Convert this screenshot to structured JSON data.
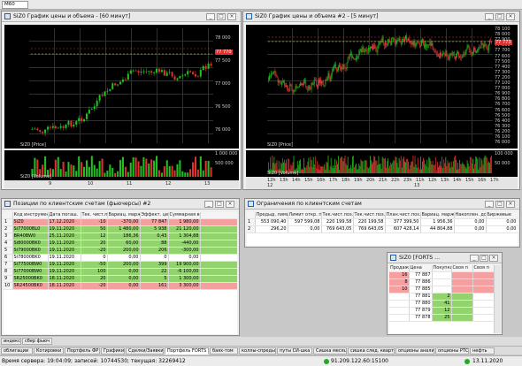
{
  "toolbar": {
    "timeframe": "M60"
  },
  "chart1": {
    "title": "SiZ0 График цены и объема - [60 минут]",
    "price_label": "SiZ0 [Price]",
    "volume_label": "SiZ0 [Volume]",
    "y_ticks": [
      "78 000",
      "77 500",
      "77 000",
      "76 500",
      "76 000"
    ],
    "last_price": "77 770",
    "vol_ticks": [
      "1 000 000",
      "500 000"
    ],
    "x_ticks": [
      "9",
      "10",
      "11",
      "12",
      "13"
    ]
  },
  "chart2": {
    "title": "SiZ0 График цены и объема #2 - [5 минут]",
    "price_label": "SiZ0 [Price]",
    "volume_label": "SiZ0 [Volume]",
    "y_ticks": [
      "78 100",
      "78 000",
      "77 900",
      "77 800",
      "77 700",
      "77 600",
      "77 500",
      "77 400",
      "77 300",
      "77 200",
      "77 100",
      "77 000",
      "76 900",
      "76 800",
      "76 700",
      "76 600",
      "76 500",
      "76 400",
      "76 300",
      "76 200",
      "76 100",
      "76 000"
    ],
    "last_price": "77 773",
    "vol_ticks": [
      "100 000",
      "50 000"
    ],
    "x_ticks": [
      "12h",
      "13h",
      "14h",
      "15h",
      "16h",
      "17h",
      "18h",
      "19h",
      "20h",
      "21h",
      "22h",
      "23h",
      "11h",
      "12h",
      "13h",
      "14h",
      "15h",
      "16h",
      "17h"
    ],
    "x_days": [
      "12",
      "13"
    ]
  },
  "positions": {
    "title": "Позиции по клиентским счетам (фьючерсы) #2",
    "headers": [
      "Код инструмента",
      "Дата погаш.",
      "Тек. чист.поз.",
      "Вариац. маржа",
      "Эффект. цена",
      "Суммарная в."
    ],
    "rows": [
      {
        "n": "1",
        "code": "SiZ0",
        "date": "17.12.2020",
        "pos": "-10",
        "vm": "-370,00",
        "price": "77 847",
        "sum": "1 980,00",
        "cls": "red"
      },
      {
        "n": "2",
        "code": "Si77000BL0",
        "date": "19.11.2020",
        "pos": "50",
        "vm": "1 480,00",
        "price": "5 938",
        "sum": "21 120,00",
        "cls": "grn"
      },
      {
        "n": "3",
        "code": "BR40BW0",
        "date": "25.11.2020",
        "pos": "12",
        "vm": "186,36",
        "price": "0,43",
        "sum": "1 304,88",
        "cls": "grn"
      },
      {
        "n": "4",
        "code": "Si80000BK0",
        "date": "19.11.2020",
        "pos": "20",
        "vm": "60,00",
        "price": "88",
        "sum": "-440,00",
        "cls": "grn"
      },
      {
        "n": "5",
        "code": "Si79000BK0",
        "date": "19.11.2020",
        "pos": "-20",
        "vm": "200,00",
        "price": "206",
        "sum": "-300,00",
        "cls": "grn"
      },
      {
        "n": "6",
        "code": "Si78000BK0",
        "date": "19.11.2020",
        "pos": "0",
        "vm": "0,00",
        "price": "0",
        "sum": "0,00",
        "cls": "gwh"
      },
      {
        "n": "7",
        "code": "Si77500BW0",
        "date": "19.11.2020",
        "pos": "-50",
        "vm": "200,00",
        "price": "399",
        "sum": "19 900,00",
        "cls": "grn"
      },
      {
        "n": "8",
        "code": "Si77000BW0",
        "date": "19.11.2020",
        "pos": "100",
        "vm": "0,00",
        "price": "22",
        "sum": "-6 100,00",
        "cls": "grn"
      },
      {
        "n": "9",
        "code": "SR25000BK0",
        "date": "18.11.2020",
        "pos": "20",
        "vm": "0,00",
        "price": "5",
        "sum": "1 300,00",
        "cls": "grn"
      },
      {
        "n": "10",
        "code": "SR24500BK0",
        "date": "18.11.2020",
        "pos": "-20",
        "vm": "0,00",
        "price": "161",
        "sum": "3 300,00",
        "cls": "red"
      }
    ]
  },
  "accounts": {
    "title": "Ограничения по клиентским счетам",
    "headers": [
      "Предыд. лими.",
      "Лимит откр. п",
      "Тек.чист.поз.",
      "Тек.чист.поз.",
      "План.чист.поз.",
      "Вариац. маржа",
      "Накоплен. доход",
      "Биржевые"
    ],
    "rows": [
      {
        "n": "1",
        "c": [
          "553 090,40",
          "597 599,08",
          "220 199,58",
          "220 199,58",
          "377 399,50",
          "1 956,36",
          "0,00",
          "0,00"
        ]
      },
      {
        "n": "2",
        "c": [
          "296,20",
          "0,00",
          "769 643,05",
          "769 643,05",
          "607 428,14",
          "44 804,88",
          "0,00",
          "0,00"
        ]
      }
    ]
  },
  "orderbook": {
    "title": "SiZ0 [FORTS ...",
    "headers": [
      "Продаж",
      "Цена",
      "Покупка",
      "Своя п",
      "Своя п"
    ],
    "rows": [
      {
        "sell": "16",
        "price": "77 887",
        "buy": "",
        "cls": "red"
      },
      {
        "sell": "8",
        "price": "77 886",
        "buy": "",
        "cls": "red"
      },
      {
        "sell": "10",
        "price": "77 885",
        "buy": "",
        "cls": "red"
      },
      {
        "sell": "",
        "price": "77 881",
        "buy": "2",
        "cls": "grn"
      },
      {
        "sell": "",
        "price": "77 880",
        "buy": "41",
        "cls": "grn"
      },
      {
        "sell": "",
        "price": "77 879",
        "buy": "12",
        "cls": "grn"
      },
      {
        "sell": "",
        "price": "77 878",
        "buy": "25",
        "cls": "grn"
      }
    ]
  },
  "tabs_row1": [
    "индекс",
    "сбер фьюч"
  ],
  "tabs_row2": [
    "облигации",
    "Котировки",
    "Портфель ФР",
    "Графики",
    "Сделки/Заявки",
    "Портфель FORTS",
    "баях-том",
    "коллы-спреды",
    "путы СИ-шка",
    "Сишка месяц",
    "сишка след. квартал",
    "опционы анализ",
    "опционы РТС",
    "нефть"
  ],
  "active_tab": "Портфель FORTS",
  "status": {
    "server_time": "Время сервера: 19:04:09; записей: 10744530; текущая: 32269412",
    "ip": "91.209.122.60:15100",
    "date": "13.11.2020"
  },
  "colors": {
    "up": "#20c020",
    "down": "#e03030",
    "status_ok": "#22aa22"
  }
}
